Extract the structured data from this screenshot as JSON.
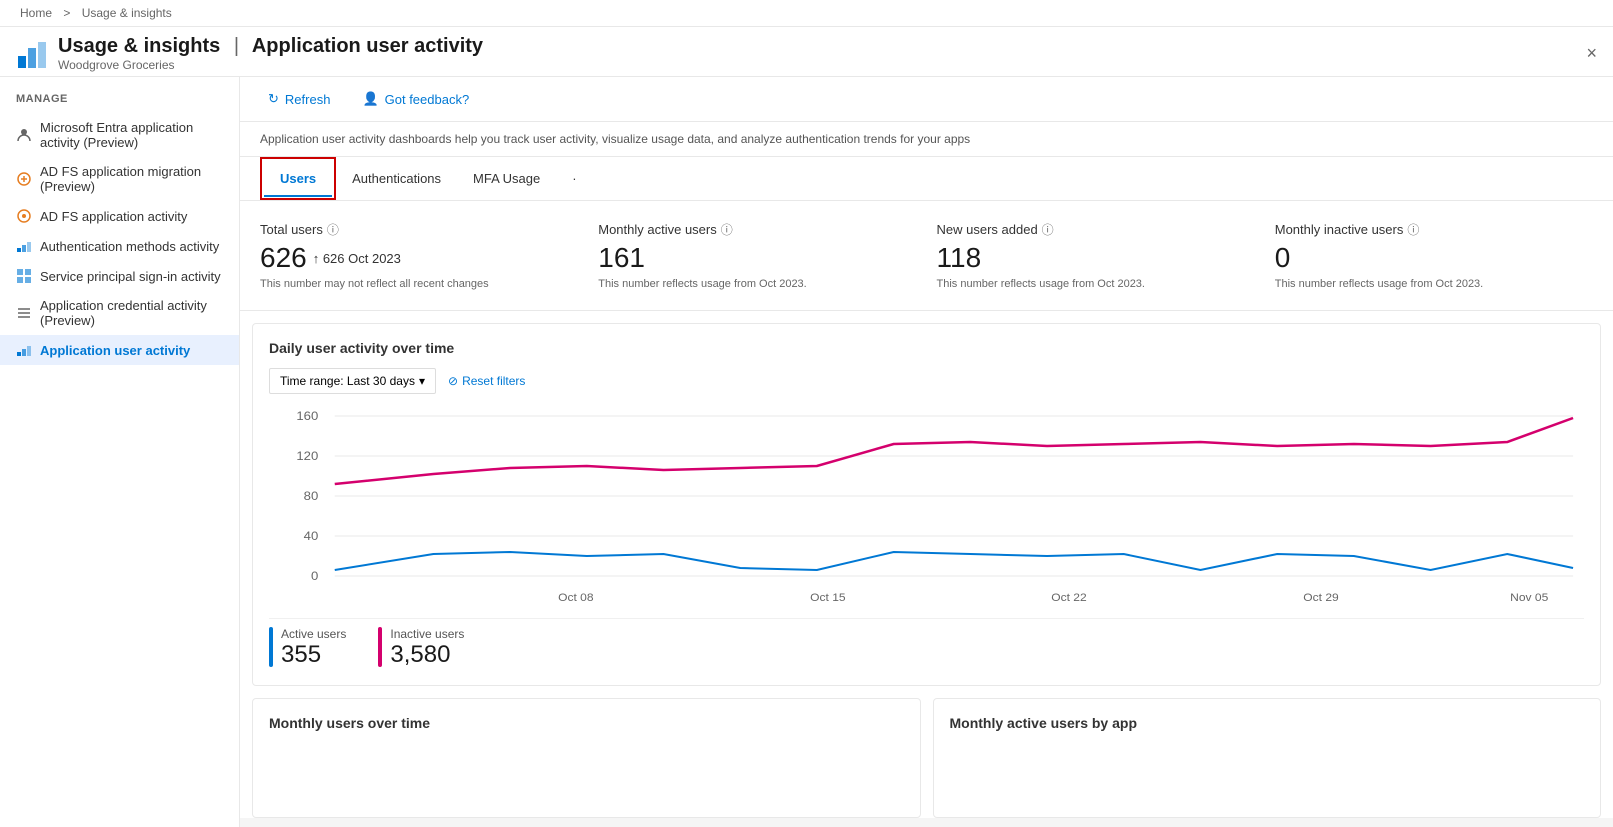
{
  "breadcrumb": {
    "home": "Home",
    "separator": ">",
    "current": "Usage & insights"
  },
  "header": {
    "title": "Usage & insights",
    "separator": "|",
    "subtitle": "Application user activity",
    "org": "Woodgrove Groceries",
    "close_label": "×"
  },
  "sidebar": {
    "section_title": "Manage",
    "items": [
      {
        "id": "entra-app-activity",
        "label": "Microsoft Entra application activity (Preview)",
        "icon": "person-icon"
      },
      {
        "id": "adfs-migration",
        "label": "AD FS application migration (Preview)",
        "icon": "adfs-icon"
      },
      {
        "id": "adfs-activity",
        "label": "AD FS application activity",
        "icon": "adfs2-icon"
      },
      {
        "id": "auth-methods",
        "label": "Authentication methods activity",
        "icon": "chart-icon"
      },
      {
        "id": "service-principal",
        "label": "Service principal sign-in activity",
        "icon": "grid-icon"
      },
      {
        "id": "app-credential",
        "label": "Application credential activity (Preview)",
        "icon": "list-icon"
      },
      {
        "id": "app-user-activity",
        "label": "Application user activity",
        "icon": "chart2-icon",
        "active": true
      }
    ]
  },
  "toolbar": {
    "refresh_label": "Refresh",
    "feedback_label": "Got feedback?"
  },
  "info_text": "Application user activity dashboards help you track user activity, visualize usage data, and analyze authentication trends for your apps",
  "tabs": [
    {
      "id": "users",
      "label": "Users",
      "active": true
    },
    {
      "id": "authentications",
      "label": "Authentications",
      "active": false
    },
    {
      "id": "mfa-usage",
      "label": "MFA Usage",
      "active": false
    },
    {
      "id": "more",
      "label": "·",
      "active": false
    }
  ],
  "stats": [
    {
      "id": "total-users",
      "label": "Total users",
      "value": "626",
      "trend": "↑ 626 Oct 2023",
      "note": "This number may not reflect all recent changes"
    },
    {
      "id": "monthly-active-users",
      "label": "Monthly active users",
      "value": "161",
      "trend": "",
      "note": "This number reflects usage from Oct 2023."
    },
    {
      "id": "new-users-added",
      "label": "New users added",
      "value": "118",
      "trend": "",
      "note": "This number reflects usage from Oct 2023."
    },
    {
      "id": "monthly-inactive-users",
      "label": "Monthly inactive users",
      "value": "0",
      "trend": "",
      "note": "This number reflects usage from Oct 2023."
    }
  ],
  "chart": {
    "title": "Daily user activity over time",
    "time_range_label": "Time range: Last 30 days",
    "reset_filters_label": "Reset filters",
    "y_axis": [
      "160",
      "120",
      "80",
      "40",
      "0"
    ],
    "x_axis": [
      "Oct 08",
      "Oct 15",
      "Oct 22",
      "Oct 29",
      "Nov 05"
    ],
    "active_users_label": "Active users",
    "active_users_value": "355",
    "inactive_users_label": "Inactive users",
    "inactive_users_value": "3,580",
    "active_color": "#0078d4",
    "inactive_color": "#d4006d"
  },
  "bottom_sections": [
    {
      "id": "monthly-users-time",
      "title": "Monthly users over time"
    },
    {
      "id": "monthly-active-by-app",
      "title": "Monthly active users by app"
    }
  ]
}
